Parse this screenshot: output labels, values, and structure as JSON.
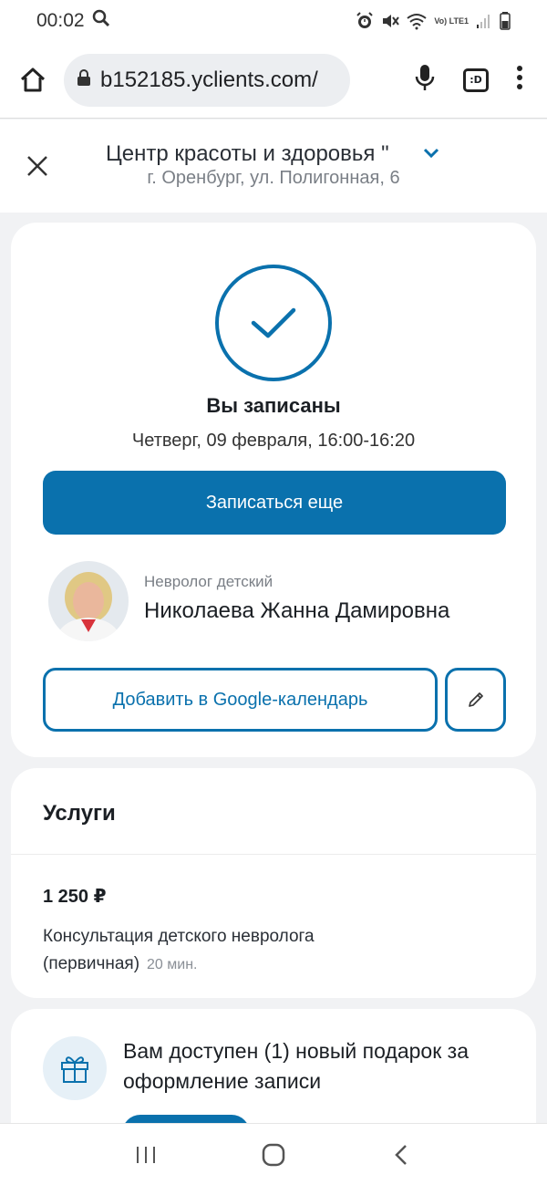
{
  "status_bar": {
    "time": "00:02",
    "network_label": "Vo) LTE1"
  },
  "browser": {
    "url": "b152185.yclients.com/",
    "tab_label": ":D"
  },
  "header": {
    "title": "Центр красоты и здоровья \"",
    "address": "г. Оренбург, ул. Полигонная, 6"
  },
  "booking": {
    "title": "Вы записаны",
    "datetime": "Четверг, 09 февраля, 16:00-16:20",
    "book_more_label": "Записаться еще",
    "add_calendar_label": "Добавить в Google-календарь"
  },
  "doctor": {
    "role": "Невролог детский",
    "name": "Николаева Жанна Дамировна"
  },
  "services": {
    "title": "Услуги",
    "items": [
      {
        "price": "1 250 ₽",
        "name": "Консультация детского невролога (первичная)",
        "duration": "20 мин."
      }
    ]
  },
  "gift": {
    "text": "Вам доступен (1) новый подарок за оформление записи"
  },
  "colors": {
    "accent": "#0a71ad"
  }
}
